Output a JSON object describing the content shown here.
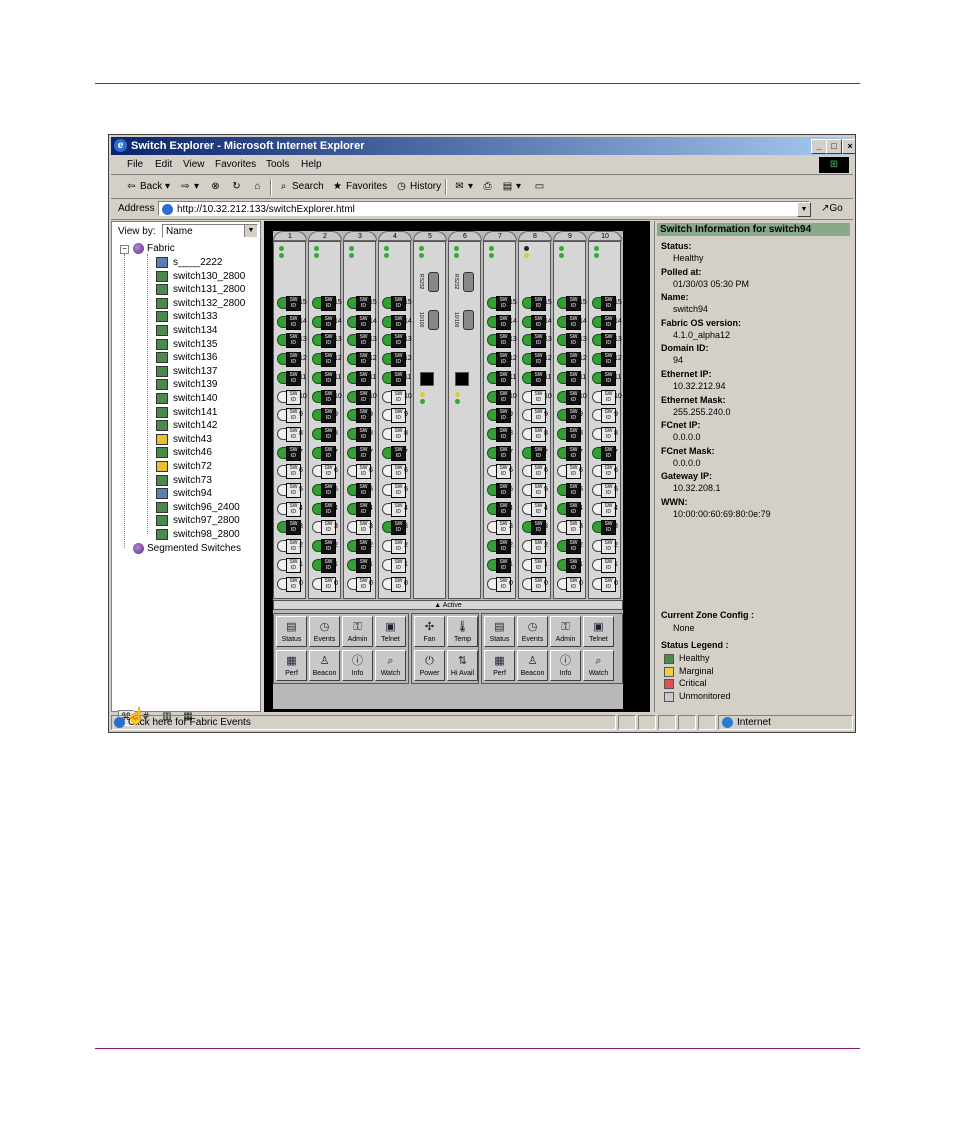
{
  "window": {
    "title": "Switch Explorer - Microsoft Internet Explorer",
    "controls": {
      "minimize": "_",
      "maximize": "□",
      "close": "×"
    }
  },
  "menu": [
    "File",
    "Edit",
    "View",
    "Favorites",
    "Tools",
    "Help"
  ],
  "toolbar": {
    "back": "Back",
    "search": "Search",
    "favorites": "Favorites",
    "history": "History"
  },
  "address": {
    "label": "Address",
    "url": "http://10.32.212.133/switchExplorer.html",
    "go": "Go"
  },
  "left": {
    "view_by_label": "View by:",
    "view_by_value": "Name",
    "fabric_label": "Fabric",
    "switches": [
      {
        "name": "s____2222",
        "status": "selected"
      },
      {
        "name": "switch130_2800",
        "status": "healthy"
      },
      {
        "name": "switch131_2800",
        "status": "healthy"
      },
      {
        "name": "switch132_2800",
        "status": "healthy"
      },
      {
        "name": "switch133",
        "status": "healthy"
      },
      {
        "name": "switch134",
        "status": "healthy"
      },
      {
        "name": "switch135",
        "status": "healthy"
      },
      {
        "name": "switch136",
        "status": "healthy"
      },
      {
        "name": "switch137",
        "status": "healthy"
      },
      {
        "name": "switch139",
        "status": "healthy"
      },
      {
        "name": "switch140",
        "status": "healthy"
      },
      {
        "name": "switch141",
        "status": "healthy"
      },
      {
        "name": "switch142",
        "status": "healthy"
      },
      {
        "name": "switch43",
        "status": "marginal"
      },
      {
        "name": "switch46",
        "status": "healthy"
      },
      {
        "name": "switch72",
        "status": "marginal"
      },
      {
        "name": "switch73",
        "status": "healthy"
      },
      {
        "name": "switch94",
        "status": "selected"
      },
      {
        "name": "switch96_2400",
        "status": "healthy"
      },
      {
        "name": "switch97_2800",
        "status": "healthy"
      },
      {
        "name": "switch98_2800",
        "status": "healthy"
      }
    ],
    "segmented_label": "Segmented Switches"
  },
  "chassis": {
    "slots": [
      "1",
      "2",
      "3",
      "4",
      "5",
      "6",
      "7",
      "8",
      "9",
      "10"
    ],
    "port_numbers": [
      "15",
      "14",
      "13",
      "12",
      "11",
      "10",
      "9",
      "8",
      "7",
      "6",
      "5",
      "4",
      "3",
      "2",
      "1",
      "0"
    ],
    "port_box_label": "SW ID",
    "cp_serial_label": "RS232",
    "cp_serial_label2": "10/100",
    "active_label": "▲ Active",
    "actions_left": [
      [
        "Status",
        "Events",
        "Admin",
        "Telnet"
      ],
      [
        "Perf",
        "Beacon",
        "Info",
        "Watch"
      ]
    ],
    "actions_mid": [
      [
        "Fan",
        "Temp"
      ],
      [
        "Power",
        "Hi Avail"
      ]
    ],
    "actions_right": [
      [
        "Status",
        "Events",
        "Admin",
        "Telnet"
      ],
      [
        "Perf",
        "Beacon",
        "Info",
        "Watch"
      ]
    ]
  },
  "info": {
    "header": "Switch Information for switch94",
    "fields": [
      {
        "k": "Status:",
        "v": "Healthy"
      },
      {
        "k": "Polled at:",
        "v": "01/30/03 05:30 PM"
      },
      {
        "k": "Name:",
        "v": "switch94"
      },
      {
        "k": "Fabric OS version:",
        "v": "4.1.0_alpha12"
      },
      {
        "k": "Domain ID:",
        "v": "94"
      },
      {
        "k": "Ethernet IP:",
        "v": "10.32.212.94"
      },
      {
        "k": "Ethernet Mask:",
        "v": "255.255.240.0"
      },
      {
        "k": "FCnet IP:",
        "v": "0.0.0.0"
      },
      {
        "k": "FCnet Mask:",
        "v": "0.0.0.0"
      },
      {
        "k": "Gateway IP:",
        "v": "10.32.208.1"
      },
      {
        "k": "WWN:",
        "v": "10:00:00:60:69:80:0e:79"
      }
    ],
    "zone_label": "Current Zone Config :",
    "zone_value": "None",
    "legend_title": "Status Legend :",
    "legend": [
      {
        "label": "Healthy",
        "color": "#4a8a4a"
      },
      {
        "label": "Marginal",
        "color": "#e8d040"
      },
      {
        "label": "Critical",
        "color": "#e05050"
      },
      {
        "label": "Unmonitored",
        "color": "#c8c8c8"
      }
    ]
  },
  "statusbar": {
    "text": "Click here for Fabric Events",
    "zone": "Internet"
  },
  "colors": {
    "rule": "#8b1a5e",
    "titlebar": "#0a246a"
  }
}
